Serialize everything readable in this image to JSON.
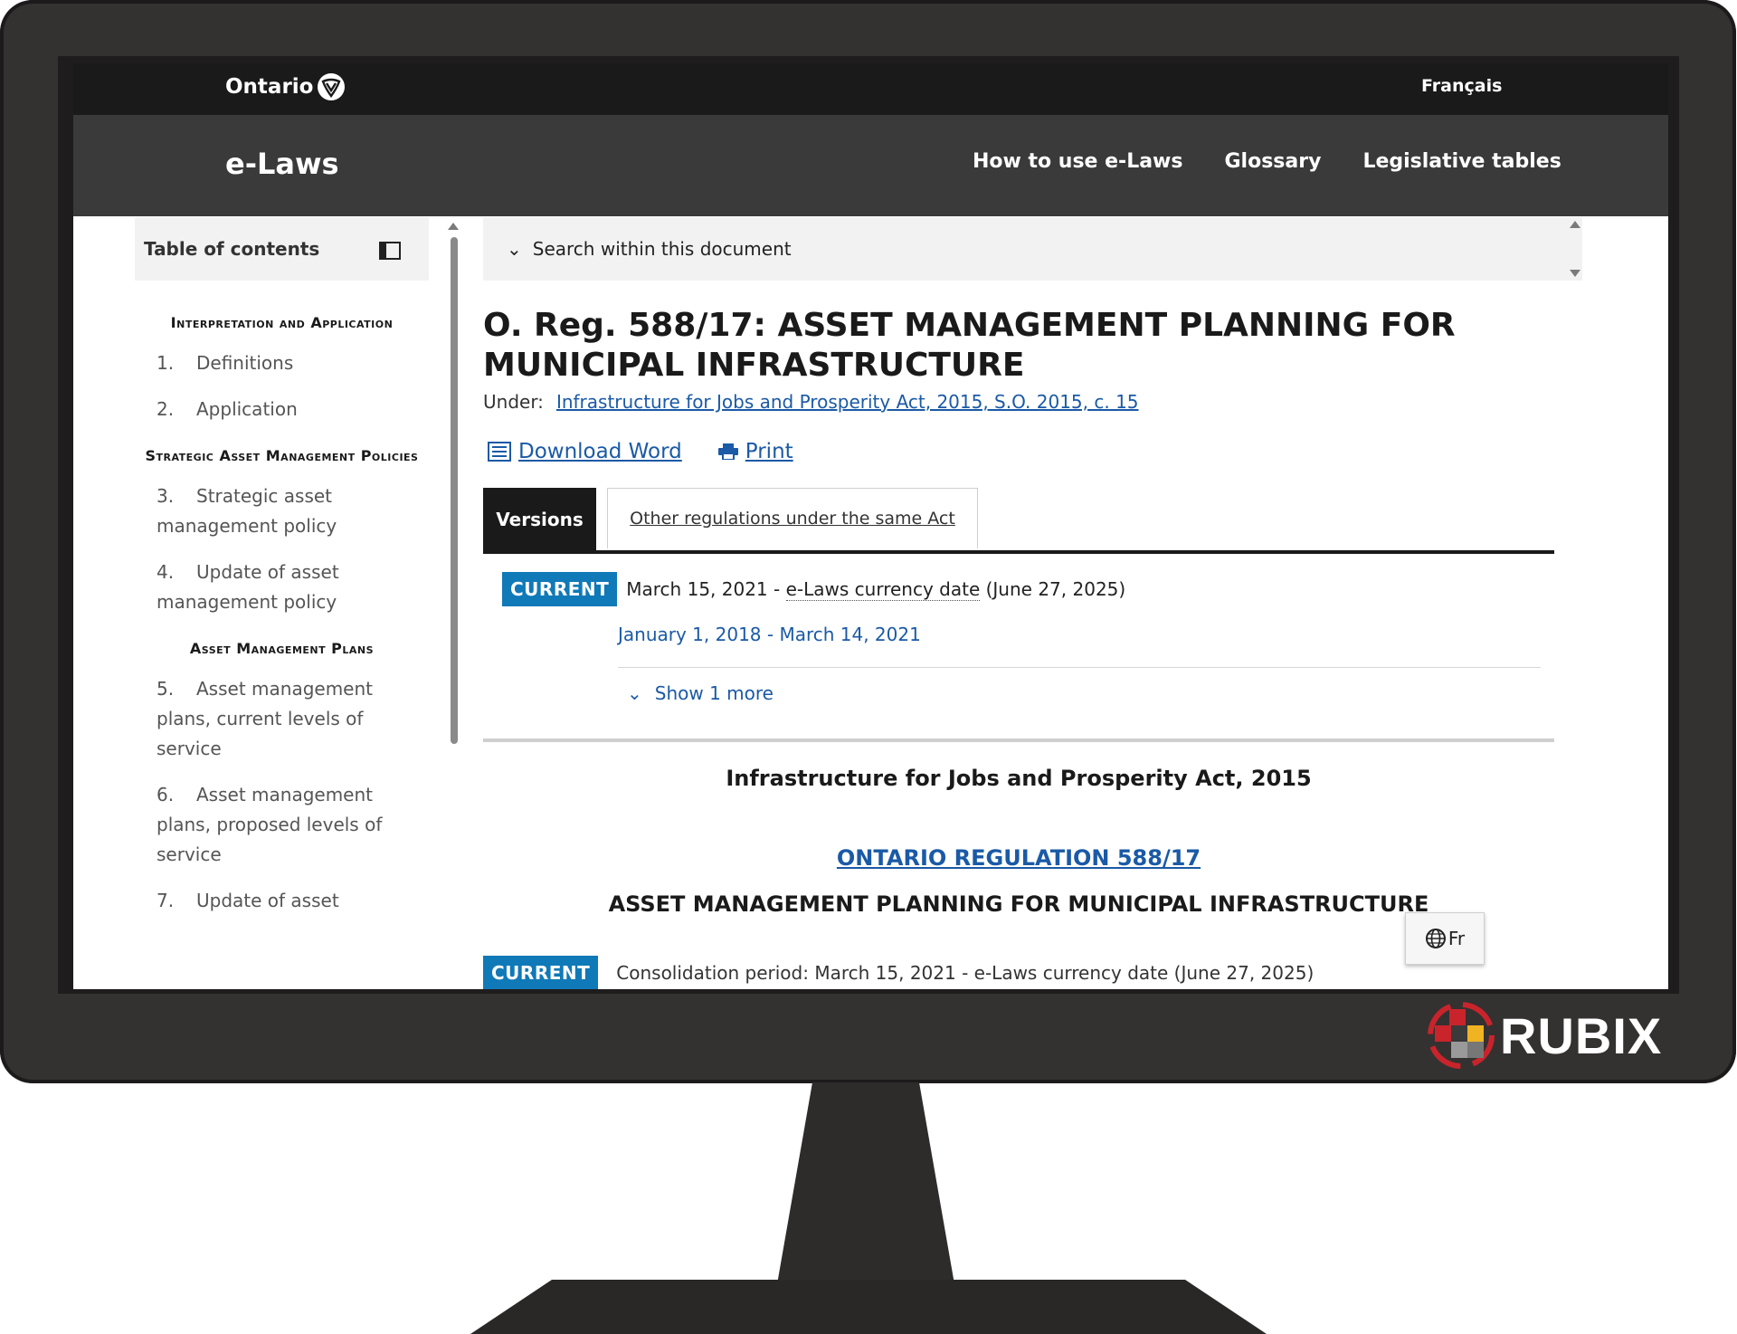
{
  "header": {
    "brand": "Ontario",
    "language_link": "Français",
    "site_name": "e-Laws",
    "nav": [
      "How to use e-Laws",
      "Glossary",
      "Legislative tables"
    ]
  },
  "sidebar": {
    "title": "Table of contents",
    "sections": [
      {
        "title": "Interpretation and Application",
        "items": [
          {
            "num": "1.",
            "label": "Definitions"
          },
          {
            "num": "2.",
            "label": "Application"
          }
        ]
      },
      {
        "title": "Strategic Asset Management Policies",
        "items": [
          {
            "num": "3.",
            "label": "Strategic asset management policy"
          },
          {
            "num": "4.",
            "label": "Update of asset management policy"
          }
        ]
      },
      {
        "title": "Asset Management Plans",
        "items": [
          {
            "num": "5.",
            "label": "Asset management plans, current levels of service"
          },
          {
            "num": "6.",
            "label": "Asset management plans, proposed levels of service"
          },
          {
            "num": "7.",
            "label": "Update of asset"
          }
        ]
      }
    ]
  },
  "main": {
    "search_label": "Search within this document",
    "title": "O. Reg. 588/17: ASSET MANAGEMENT PLANNING FOR MUNICIPAL INFRASTRUCTURE",
    "under_label": "Under:",
    "under_link": "Infrastructure for Jobs and Prosperity Act, 2015, S.O. 2015, c. 15",
    "download_label": "Download Word",
    "print_label": "Print",
    "tabs": [
      {
        "label": "Versions",
        "active": true
      },
      {
        "label": "Other regulations under the same Act",
        "active": false
      }
    ],
    "current_badge": "CURRENT",
    "current_version_start": "March 15, 2021 -",
    "currency_date_label": "e-Laws currency date",
    "current_version_end": "(June 27, 2025)",
    "previous_version": "January 1, 2018 - March 14, 2021",
    "show_more": "Show 1 more",
    "act_name": "Infrastructure for Jobs and Prosperity Act, 2015",
    "regulation_link": "ONTARIO REGULATION 588/17",
    "regulation_title": "ASSET MANAGEMENT PLANNING FOR MUNICIPAL INFRASTRUCTURE",
    "consolidation_badge": "CURRENT",
    "consolidation_text": "Consolidation period: March 15, 2021 - e-Laws currency date (June 27, 2025)",
    "fr_button": "Fr"
  },
  "watermark": {
    "brand": "RUBIX"
  },
  "colors": {
    "badge": "#1079b8",
    "link": "#1a5aa6",
    "topbar": "#1a1a1a",
    "subbar": "#3a3a3a",
    "bezel": "#343131"
  }
}
